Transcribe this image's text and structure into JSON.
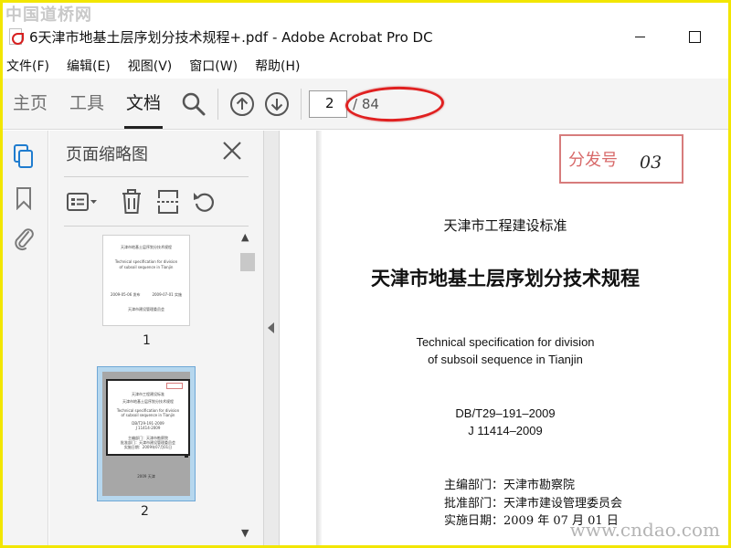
{
  "watermark": {
    "top": "中国道桥网",
    "bottom": "www.cndao.com"
  },
  "window": {
    "title": "6天津市地基土层序划分技术规程+.pdf - Adobe Acrobat Pro DC"
  },
  "menu": [
    "文件(F)",
    "编辑(E)",
    "视图(V)",
    "窗口(W)",
    "帮助(H)"
  ],
  "toolbar": {
    "tabs": [
      "主页",
      "工具",
      "文档"
    ],
    "active_tab": "文档",
    "current_page": "2",
    "total_pages": "/ 84"
  },
  "panel": {
    "title": "页面缩略图"
  },
  "thumbnails": [
    {
      "label": "1",
      "lines": [
        "天津市地基土层序划分技术规程",
        "Technical specification for division",
        "of subsoil sequence in Tianjin",
        "2009-05-06 发布",
        "2009-07-01 实施",
        "天津市建设管理委员会"
      ]
    },
    {
      "label": "2",
      "lines": [
        "天津市工程建设标准",
        "天津市地基土层序划分技术规程",
        "Technical specification for division",
        "of subsoil sequence in Tianjin",
        "DB/T29-191-2009",
        "J 11414-2009",
        "主编部门：天津市勘察院",
        "批准部门：天津市建设管理委员会",
        "实施日期：2009年07月01日",
        "2009 天津"
      ]
    }
  ],
  "document": {
    "stamp_label": "分发号",
    "stamp_number": "03",
    "standard_type": "天津市工程建设标准",
    "title_cn": "天津市地基土层序划分技术规程",
    "title_en_line1": "Technical specification for division",
    "title_en_line2": "of subsoil sequence in Tianjin",
    "code1": "DB/T29–191–2009",
    "code2": "J 11414–2009",
    "editor": "主编部门：天津市勘察院",
    "approver": "批准部门：天津市建设管理委员会",
    "date": "实施日期：2009 年 07 月 01 日"
  },
  "colors": {
    "annotation_ellipse": "#e02020",
    "selection": "#b6d7ee",
    "frame": "#f2e600"
  },
  "icons": [
    "pdf-file-icon",
    "search-icon",
    "arrow-up-icon",
    "arrow-down-icon",
    "pages-icon",
    "bookmark-icon",
    "paperclip-icon",
    "close-icon",
    "options-icon",
    "trash-icon",
    "extract-icon",
    "rotate-icon"
  ]
}
